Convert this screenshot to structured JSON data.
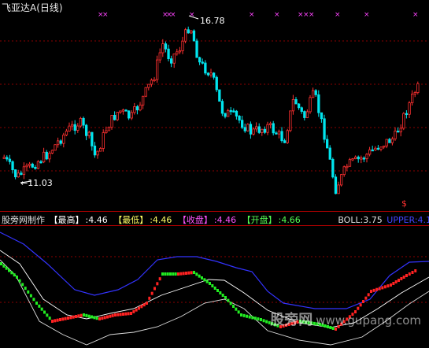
{
  "window": {
    "title": "飞亚达A",
    "period": "(日线)"
  },
  "upper_panel": {
    "high_label": "16.78",
    "low_label": "11.03",
    "signal_marker": "$"
  },
  "indicator_bar": {
    "name": "股旁网制作",
    "items": [
      {
        "label": "【最高】",
        "value": ":4.46",
        "color": "#ffffff"
      },
      {
        "label": "【最低】",
        "value": ":4.46",
        "color": "#ffff66"
      },
      {
        "label": "【收盘】",
        "value": ":4.46",
        "color": "#ff55ff"
      },
      {
        "label": "【开盘】",
        "value": ":4.66",
        "color": "#55ff55"
      }
    ],
    "boll": "BOLL:3.75",
    "upper": "UPPER:4.1"
  },
  "watermark": {
    "brand": "股旁网",
    "url": "www.gupang.com"
  },
  "colors": {
    "up": "#ff3030",
    "down": "#00e5ee",
    "grid": "#8b0000",
    "cross": "#ff44ff",
    "boll_mid": "#ffffff",
    "upper": "#3333ff",
    "rising": "#ff2222",
    "falling": "#22ee22"
  }
}
